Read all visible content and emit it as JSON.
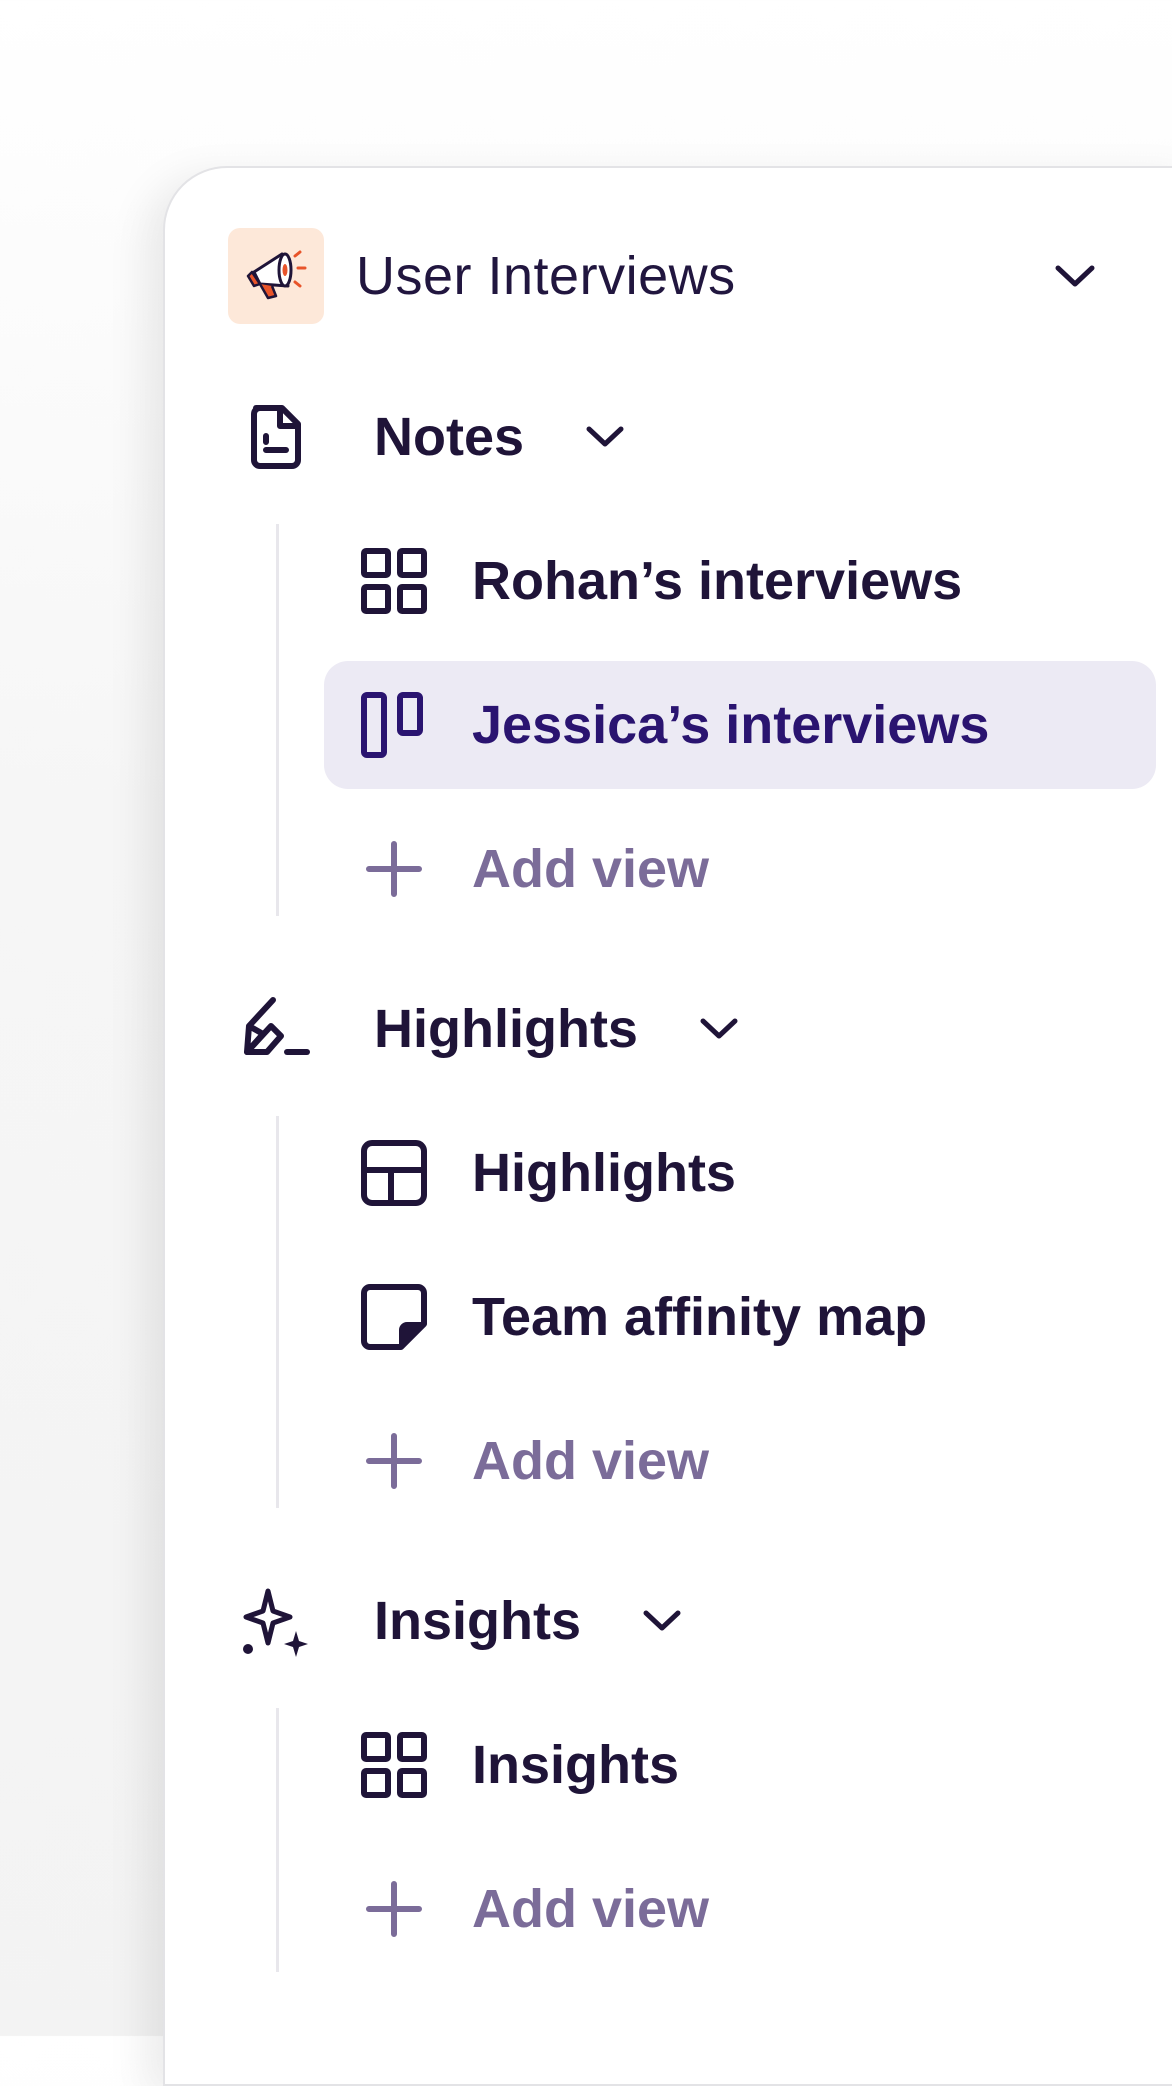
{
  "project": {
    "title": "User Interviews",
    "avatar_icon": "megaphone-icon",
    "chevron_icon": "chevron-down-icon"
  },
  "sections": [
    {
      "label": "Notes",
      "icon": "document-icon",
      "views": [
        {
          "label": "Rohan’s interviews",
          "icon": "grid-icon",
          "active": false
        },
        {
          "label": "Jessica’s interviews",
          "icon": "board-columns-icon",
          "active": true
        }
      ],
      "add_label": "Add view"
    },
    {
      "label": "Highlights",
      "icon": "highlighter-icon",
      "views": [
        {
          "label": "Highlights",
          "icon": "table-icon",
          "active": false
        },
        {
          "label": "Team affinity map",
          "icon": "sticky-note-icon",
          "active": false
        }
      ],
      "add_label": "Add view"
    },
    {
      "label": "Insights",
      "icon": "sparkles-icon",
      "views": [
        {
          "label": "Insights",
          "icon": "grid-icon",
          "active": false
        }
      ],
      "add_label": "Add view"
    }
  ],
  "colors": {
    "text_primary": "#1f1438",
    "text_active": "#2a1470",
    "text_muted": "#7b6c99",
    "active_bg": "#eceaf4",
    "avatar_bg": "#fde8d9",
    "megaphone_accent": "#e8542a"
  }
}
